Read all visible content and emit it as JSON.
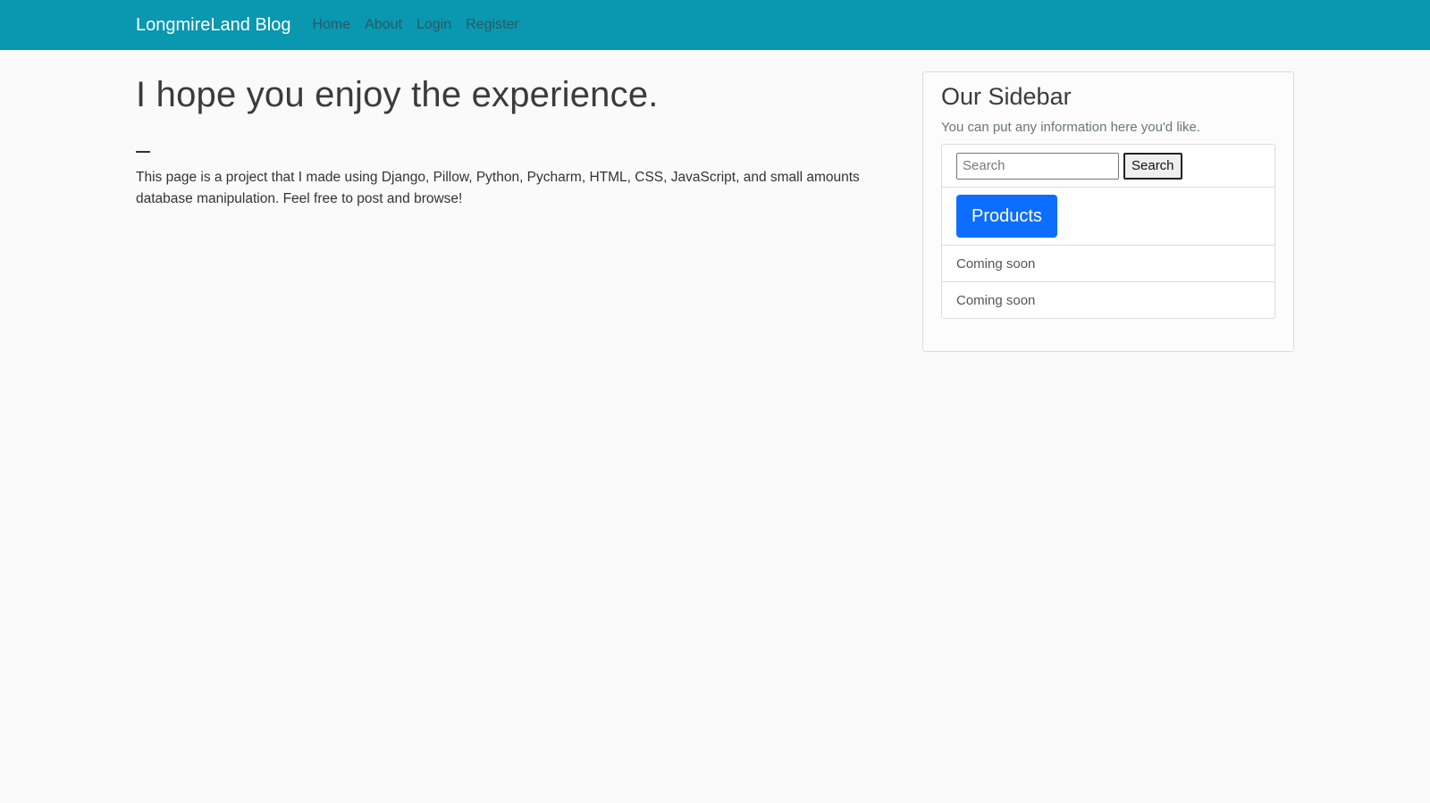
{
  "navbar": {
    "brand": "LongmireLand Blog",
    "links": [
      "Home",
      "About",
      "Login",
      "Register"
    ],
    "background": "#0a97b0"
  },
  "main": {
    "heading": "I hope you enjoy the experience.",
    "paragraph": "This page is a project that I made using Django, Pillow, Python, Pycharm, HTML, CSS, JavaScript, and small amounts database manipulation. Feel free to post and browse!"
  },
  "sidebar": {
    "title": "Our Sidebar",
    "lead": "You can put any information here you'd like.",
    "search": {
      "placeholder": "Search",
      "button_label": "Search"
    },
    "products_label": "Products",
    "products_color": "#0d6efd",
    "items": [
      "Coming soon",
      "Coming soon"
    ]
  }
}
